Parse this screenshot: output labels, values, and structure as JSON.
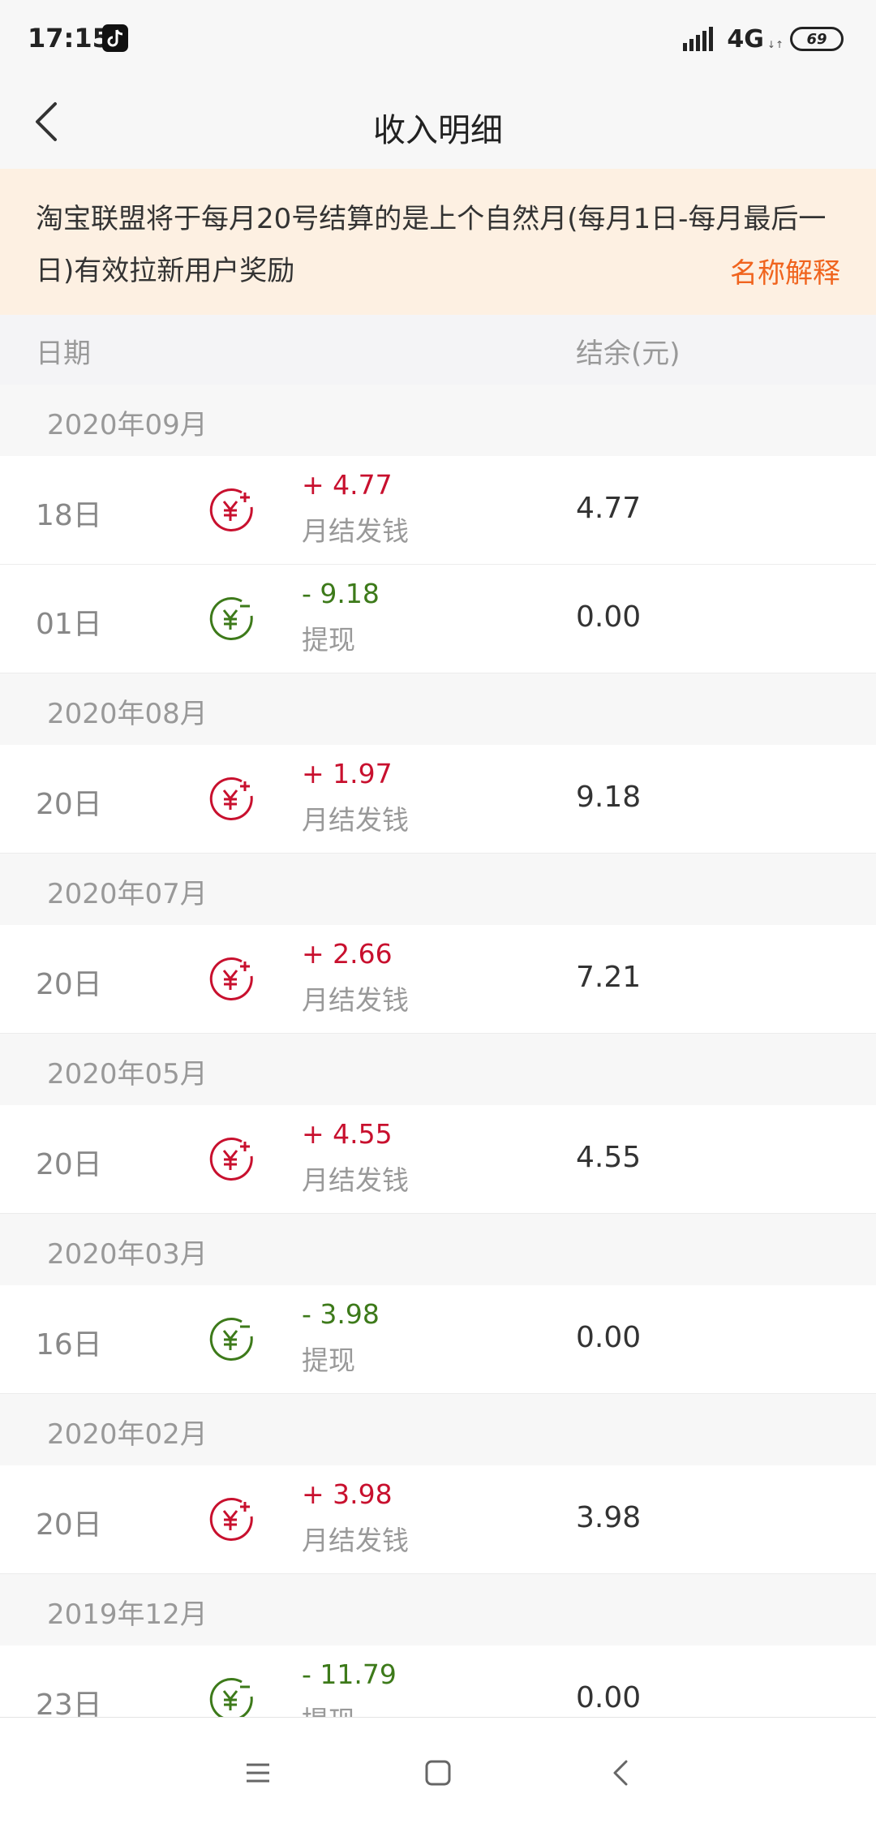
{
  "status_bar": {
    "time": "17:15",
    "network": "4G",
    "network_arrows": "↓↑",
    "battery": "69"
  },
  "header": {
    "title": "收入明细"
  },
  "notice": {
    "text": "淘宝联盟将于每月20号结算的是上个自然月(每月1日-每月最后一日)有效拉新用户奖励",
    "link": "名称解释"
  },
  "columns": {
    "date": "日期",
    "balance": "结余(元)"
  },
  "colors": {
    "income": "#c8102e",
    "withdraw": "#3d7a1a",
    "link": "#f0641e",
    "notice_bg": "#fdf0e2"
  },
  "months": [
    {
      "label": "2020年09月",
      "entries": [
        {
          "day": "18日",
          "type": "income",
          "icon": "yuan-plus-icon",
          "amount": "+ 4.77",
          "desc": "月结发钱",
          "balance": "4.77"
        },
        {
          "day": "01日",
          "type": "withdraw",
          "icon": "yuan-minus-icon",
          "amount": "- 9.18",
          "desc": "提现",
          "balance": "0.00"
        }
      ]
    },
    {
      "label": "2020年08月",
      "entries": [
        {
          "day": "20日",
          "type": "income",
          "icon": "yuan-plus-icon",
          "amount": "+ 1.97",
          "desc": "月结发钱",
          "balance": "9.18"
        }
      ]
    },
    {
      "label": "2020年07月",
      "entries": [
        {
          "day": "20日",
          "type": "income",
          "icon": "yuan-plus-icon",
          "amount": "+ 2.66",
          "desc": "月结发钱",
          "balance": "7.21"
        }
      ]
    },
    {
      "label": "2020年05月",
      "entries": [
        {
          "day": "20日",
          "type": "income",
          "icon": "yuan-plus-icon",
          "amount": "+ 4.55",
          "desc": "月结发钱",
          "balance": "4.55"
        }
      ]
    },
    {
      "label": "2020年03月",
      "entries": [
        {
          "day": "16日",
          "type": "withdraw",
          "icon": "yuan-minus-icon",
          "amount": "- 3.98",
          "desc": "提现",
          "balance": "0.00"
        }
      ]
    },
    {
      "label": "2020年02月",
      "entries": [
        {
          "day": "20日",
          "type": "income",
          "icon": "yuan-plus-icon",
          "amount": "+ 3.98",
          "desc": "月结发钱",
          "balance": "3.98"
        }
      ]
    },
    {
      "label": "2019年12月",
      "entries": [
        {
          "day": "23日",
          "type": "withdraw",
          "icon": "yuan-minus-icon",
          "amount": "- 11.79",
          "desc": "提现",
          "balance": "0.00"
        }
      ]
    }
  ],
  "nav": {
    "menu_icon": "menu-icon",
    "home_icon": "home-square-icon",
    "back_icon": "back-triangle-icon"
  }
}
